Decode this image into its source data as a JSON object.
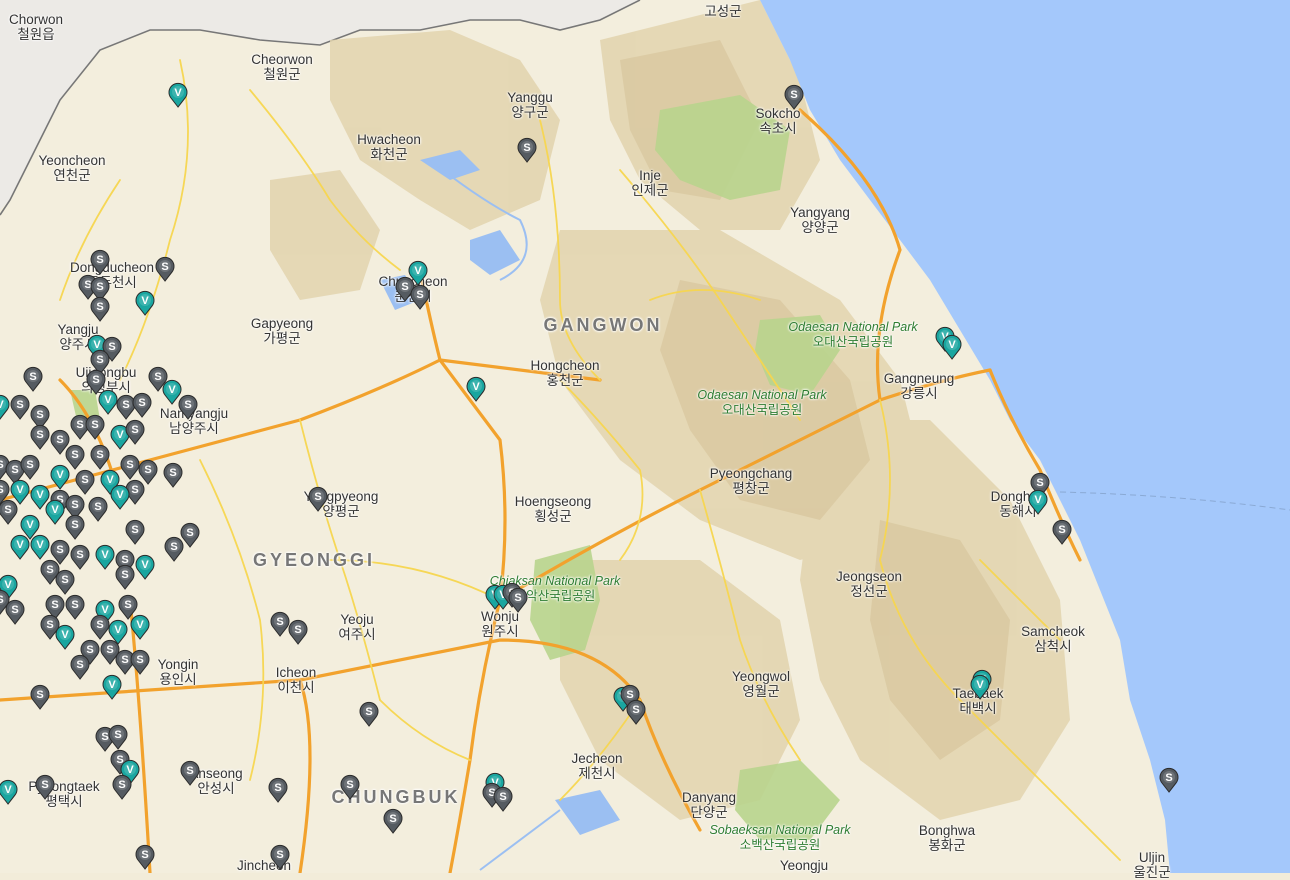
{
  "map": {
    "region_labels": [
      {
        "id": "gangwon",
        "en": "GANGWON",
        "ko": ""
      },
      {
        "id": "gyeonggi",
        "en": "GYEONGGI",
        "ko": ""
      },
      {
        "id": "chungbuk",
        "en": "CHUNGBUK",
        "ko": ""
      }
    ],
    "place_labels": [
      {
        "id": "chorwon",
        "en": "Chorwon",
        "ko": "철원읍"
      },
      {
        "id": "goseong",
        "en": "",
        "ko": "고성군"
      },
      {
        "id": "cheorwon",
        "en": "Cheorwon",
        "ko": "철원군"
      },
      {
        "id": "yanggu",
        "en": "Yanggu",
        "ko": "양구군"
      },
      {
        "id": "sokcho",
        "en": "Sokcho",
        "ko": "속초시"
      },
      {
        "id": "hwacheon",
        "en": "Hwacheon",
        "ko": "화천군"
      },
      {
        "id": "yeoncheon",
        "en": "Yeoncheon",
        "ko": "연천군"
      },
      {
        "id": "inje",
        "en": "Inje",
        "ko": "인제군"
      },
      {
        "id": "yangyang",
        "en": "Yangyang",
        "ko": "양양군"
      },
      {
        "id": "dongducheon",
        "en": "Dongducheon",
        "ko": "동두천시"
      },
      {
        "id": "chuncheon",
        "en": "Chuncheon",
        "ko": "춘천시"
      },
      {
        "id": "gapyeong",
        "en": "Gapyeong",
        "ko": "가평군"
      },
      {
        "id": "yangju",
        "en": "Yangju",
        "ko": "양주시"
      },
      {
        "id": "uijeongbu",
        "en": "Uijeongbu",
        "ko": "의정부시"
      },
      {
        "id": "namyangju",
        "en": "Namyangju",
        "ko": "남양주시"
      },
      {
        "id": "hongcheon",
        "en": "Hongcheon",
        "ko": "홍천군"
      },
      {
        "id": "gangneung",
        "en": "Gangneung",
        "ko": "강릉시"
      },
      {
        "id": "pyeongchang",
        "en": "Pyeongchang",
        "ko": "평창군"
      },
      {
        "id": "yangpyeong",
        "en": "Yangpyeong",
        "ko": "양평군"
      },
      {
        "id": "hoengseong",
        "en": "Hoengseong",
        "ko": "횡성군"
      },
      {
        "id": "donghae",
        "en": "Donghae",
        "ko": "동해시"
      },
      {
        "id": "jeongseon",
        "en": "Jeongseon",
        "ko": "정선군"
      },
      {
        "id": "yeoju",
        "en": "Yeoju",
        "ko": "여주시"
      },
      {
        "id": "wonju",
        "en": "Wonju",
        "ko": "원주시"
      },
      {
        "id": "samcheok",
        "en": "Samcheok",
        "ko": "삼척시"
      },
      {
        "id": "yongin",
        "en": "Yongin",
        "ko": "용인시"
      },
      {
        "id": "icheon",
        "en": "Icheon",
        "ko": "이천시"
      },
      {
        "id": "yeongwol",
        "en": "Yeongwol",
        "ko": "영월군"
      },
      {
        "id": "taebaek",
        "en": "Taebaek",
        "ko": "태백시"
      },
      {
        "id": "jecheon",
        "en": "Jecheon",
        "ko": "제천시"
      },
      {
        "id": "anseong",
        "en": "Anseong",
        "ko": "안성시"
      },
      {
        "id": "pyeongtaek",
        "en": "Pyeongtaek",
        "ko": "평택시"
      },
      {
        "id": "danyang",
        "en": "Danyang",
        "ko": "단양군"
      },
      {
        "id": "bonghwa",
        "en": "Bonghwa",
        "ko": "봉화군"
      },
      {
        "id": "ulijn",
        "en": "Uljin",
        "ko": "울진군"
      },
      {
        "id": "yeongju",
        "en": "Yeongju",
        "ko": ""
      },
      {
        "id": "jincheon",
        "en": "Jincheon",
        "ko": ""
      }
    ],
    "park_labels": [
      {
        "id": "odaesan1",
        "en": "Odaesan National Park",
        "ko": "오대산국립공원"
      },
      {
        "id": "odaesan2",
        "en": "Odaesan National Park",
        "ko": "오대산국립공원"
      },
      {
        "id": "chiaksan",
        "en": "Chiaksan National Park",
        "ko": "치악산국립공원"
      },
      {
        "id": "sobaeksan",
        "en": "Sobaeksan National Park",
        "ko": "소백산국립공원"
      }
    ],
    "marker_types": {
      "S": {
        "letter": "S",
        "color": "#555b61"
      },
      "V": {
        "letter": "V",
        "color": "#1aa6a0"
      }
    }
  }
}
